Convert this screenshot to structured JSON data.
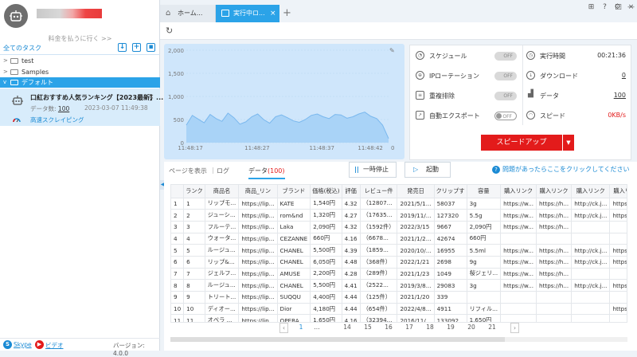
{
  "sidebar": {
    "upgrade_link": "料金を払うに行く >>",
    "all_tasks": "全てのタスク",
    "tree": [
      {
        "label": "test",
        "expanded": false
      },
      {
        "label": "Samples",
        "expanded": false
      },
      {
        "label": "デフォルト",
        "expanded": true,
        "selected": true
      }
    ],
    "task": {
      "title": "口紅おすすめ人気ランキング【2023最新】...",
      "data_count_label": "データ数:",
      "data_count": "100",
      "time": "2023-03-07 11:49:38",
      "mode": "高速スクレイピング"
    },
    "footer": {
      "skype": "Skype",
      "video": "ビデオ",
      "version": "バージョン: 4.0.0"
    }
  },
  "tabs": {
    "home": "ホーム...",
    "task": "実行中ロ..."
  },
  "chart_data": {
    "type": "area",
    "x_ticks": [
      "11:48:17",
      "11:48:27",
      "11:48:37",
      "11:48:42"
    ],
    "y_ticks": [
      "2,000",
      "1,500",
      "1,000",
      "500",
      "0"
    ],
    "ylim": [
      0,
      2000
    ],
    "right_y_tick": "0",
    "series": [
      {
        "values": [
          380,
          590,
          510,
          430,
          610,
          520,
          460,
          640,
          540,
          400,
          450,
          560,
          620,
          500,
          420,
          560,
          600,
          540,
          470,
          440,
          500,
          590,
          620,
          560,
          520,
          610,
          600,
          530,
          560,
          620,
          660,
          570,
          520,
          380,
          90
        ]
      }
    ],
    "fill_color": "#a9d3f7",
    "line_color": "#7ab8ee"
  },
  "stats": {
    "left": [
      {
        "icon": "clock-icon",
        "label": "スケジュール",
        "toggle": "OFF"
      },
      {
        "icon": "globe-icon",
        "label": "IPローテーション",
        "toggle": "OFF"
      },
      {
        "icon": "dedupe-icon",
        "label": "重複排除",
        "toggle": "OFF"
      },
      {
        "icon": "export-icon",
        "label": "自動エクスポート",
        "toggle": "OFF"
      }
    ],
    "right": [
      {
        "icon": "timer-icon",
        "label": "実行時間",
        "value": "00:21:36"
      },
      {
        "icon": "download-icon",
        "label": "ダウンロード",
        "value": "0"
      },
      {
        "icon": "data-icon",
        "label": "データ",
        "value": "100"
      },
      {
        "icon": "speed-icon",
        "label": "スピード",
        "value": "0KB/s"
      }
    ],
    "speedup": "スピードアップ"
  },
  "lower": {
    "tab_page": "ページを表示",
    "tab_log": "ログ",
    "tab_data": "データ",
    "data_count": "(100)",
    "pause": "一時停止",
    "start": "起動",
    "help": "問題があったらここをクリックしてください"
  },
  "table": {
    "headers": [
      "",
      "ランク",
      "商品名",
      "商品_リン",
      "ブランド",
      "価格(税込)",
      "評価",
      "レビュー件",
      "発売日",
      "クリップす",
      "容量",
      "購入リンク",
      "購入リンク",
      "購入リンク",
      "購入リンク"
    ],
    "rows": [
      [
        "1",
        "1",
        "リップモ...",
        "https://lip...",
        "KATE",
        "1,540円",
        "4.32",
        "（12807...",
        "2021/5/1...",
        "58037",
        "3g",
        "https://w...",
        "https://h...",
        "http://ck.j...",
        "https://w..."
      ],
      [
        "2",
        "2",
        "ジューシ...",
        "https://lip...",
        "rom&nd",
        "1,320円",
        "4.27",
        "（17635...",
        "2019/11/...",
        "127320",
        "5.5g",
        "https://w...",
        "https://h...",
        "http://ck.j...",
        "https://w..."
      ],
      [
        "3",
        "3",
        "フルーテ...",
        "https://lip...",
        "Laka",
        "2,090円",
        "4.32",
        "（1592件）",
        "2022/3/15",
        "9667",
        "2,090円",
        "https://w...",
        "https://h...",
        "",
        ""
      ],
      [
        "4",
        "4",
        "ウォータ...",
        "https://lip...",
        "CEZANNE",
        "660円",
        "4.16",
        "（6678...",
        "2021/1/2...",
        "42674",
        "660円",
        "",
        "",
        "",
        ""
      ],
      [
        "5",
        "5",
        "ルージュ...",
        "https://lip...",
        "CHANEL",
        "5,500円",
        "4.39",
        "（1859...",
        "2020/10/...",
        "16955",
        "5.5ml",
        "https://w...",
        "https://h...",
        "http://ck.j...",
        "https://w..."
      ],
      [
        "6",
        "6",
        "リップ&...",
        "https://lip...",
        "CHANEL",
        "6,050円",
        "4.48",
        "（368件）",
        "2022/1/21",
        "2698",
        "9g",
        "https://w...",
        "https://h...",
        "http://ck.j...",
        "https://w..."
      ],
      [
        "7",
        "7",
        "ジェルフ...",
        "https://lip...",
        "AMUSE",
        "2,200円",
        "4.28",
        "（289件）",
        "2021/1/23",
        "1049",
        "桜ジェリ...",
        "https://w...",
        "https://h...",
        "",
        ""
      ],
      [
        "8",
        "8",
        "ルージュ...",
        "https://lip...",
        "CHANEL",
        "5,500円",
        "4.41",
        "（2522...",
        "2019/3/8...",
        "29083",
        "3g",
        "https://w...",
        "https://h...",
        "http://ck.j...",
        "https://w..."
      ],
      [
        "9",
        "9",
        "トリート...",
        "https://lip...",
        "SUQQU",
        "4,400円",
        "4.44",
        "（125件）",
        "2021/1/20",
        "339",
        "",
        "",
        "",
        "",
        ""
      ],
      [
        "10",
        "10",
        "ディオー...",
        "https://lip...",
        "Dior",
        "4,180円",
        "4.44",
        "（654件）",
        "2022/4/8...",
        "4911",
        "リフィル...",
        "",
        "",
        "",
        "https://a..."
      ],
      [
        "11",
        "11",
        "オペラ ...",
        "https://lip...",
        "OPERA",
        "1,650円",
        "4.16",
        "（32394...",
        "2016/11/...",
        "133092",
        "1,650円",
        "",
        "",
        "",
        ""
      ]
    ]
  },
  "pager": {
    "pages": [
      "1",
      "...",
      "14",
      "15",
      "16",
      "17",
      "18",
      "19",
      "20",
      "21"
    ],
    "current": "1"
  }
}
